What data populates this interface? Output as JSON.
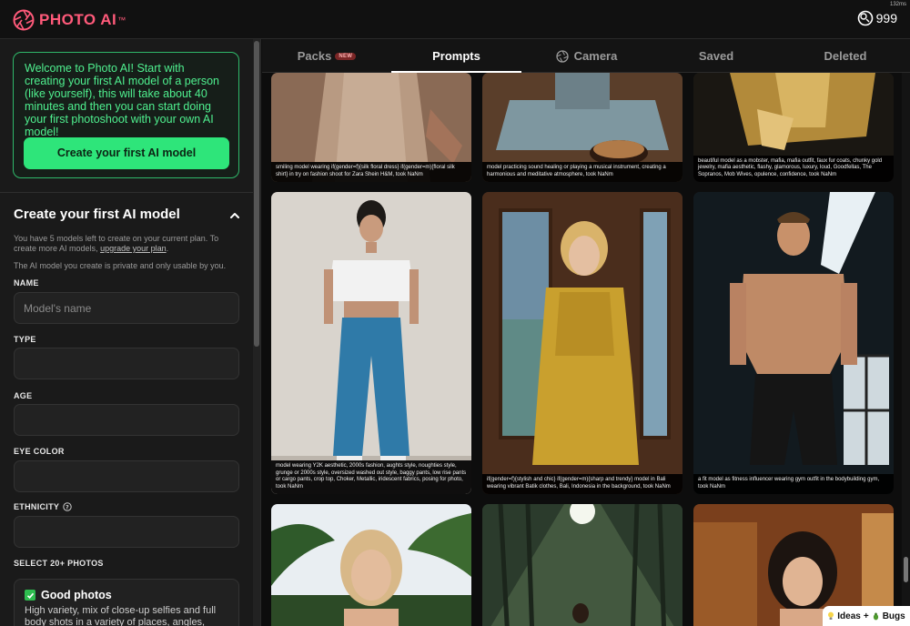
{
  "brand": {
    "name": "PHOTO AI",
    "tm": "™",
    "accent": "#ff5a7a"
  },
  "header": {
    "credits": "999",
    "render_time": "132ms"
  },
  "sidebar": {
    "welcome_text": "Welcome to Photo AI! Start with creating your first AI model of a person (like yourself), this will take about 40 minutes and then you can start doing your first photoshoot with your own AI model!",
    "create_button": "Create your first AI model",
    "section_title": "Create your first AI model",
    "help_prefix": "You have 5 models left to create on your current plan. To create more AI models,",
    "help_link": "upgrade your plan",
    "help_suffix": ".",
    "private_note": "The AI model you create is private and only usable by you.",
    "fields": {
      "name_label": "NAME",
      "name_placeholder": "Model's name",
      "type_label": "TYPE",
      "age_label": "AGE",
      "eye_label": "EYE COLOR",
      "ethnicity_label": "ETHNICITY"
    },
    "photos_label": "SELECT 20+ PHOTOS",
    "good_photos": {
      "title": "Good photos",
      "desc": "High variety, mix of close-up selfies and full body shots in a variety of places, angles, clothes"
    }
  },
  "tabs": {
    "packs": "Packs",
    "packs_badge": "NEW",
    "prompts": "Prompts",
    "camera": "Camera",
    "saved": "Saved",
    "deleted": "Deleted"
  },
  "gallery": {
    "row1": [
      "smiling model wearing if(gender=f){silk floral dress} if(gender=m){floral silk shirt} in try on fashion shoot for Zara Shein H&M, took NaNm",
      "model practicing sound healing or playing a musical instrument, creating a harmonious and meditative atmosphere, took NaNm",
      "beautiful model as a mobster, mafia, mafia outfit, faux fur coats, chunky gold jewelry, mafia aesthetic, flashy, glamorous, luxury, loud, Goodfellas, The Sopranos, Mob Wives, opulence, confidence, took NaNm"
    ],
    "row2": [
      "model wearing Y2K aesthetic, 2000s fashion, aughts style, noughties style, grunge or 2000s style, oversized washed out style, baggy pants, low rise pants or cargo pants, crop top, Choker, Metallic, iridescent fabrics, posing for photo, took NaNm",
      "if(gender=f){stylish and chic} if(gender=m){sharp and trendy} model in Bali wearing vibrant Batik clothes, Bali, Indonesia in the background, took NaNm",
      "a fit model as fitness influencer wearing gym outfit in the bodybuilding gym, took NaNm"
    ]
  },
  "feedback": {
    "ideas": "Ideas",
    "plus": "+",
    "bugs": "Bugs"
  }
}
